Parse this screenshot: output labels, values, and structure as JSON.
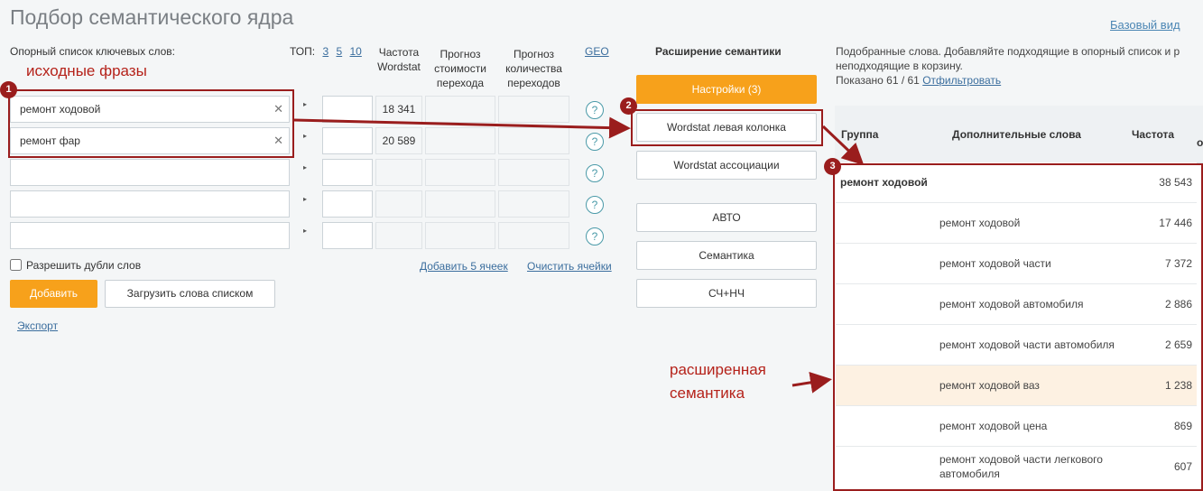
{
  "page": {
    "title": "Подбор семантического ядра",
    "base_view_link": "Базовый вид"
  },
  "keywords": {
    "label": "Опорный список ключевых слов:",
    "top_label": "ТОП:",
    "top_options": [
      "3",
      "5",
      "10"
    ],
    "col_freq": [
      "Частота",
      "Wordstat"
    ],
    "col_cost": [
      "Прогноз",
      "стоимости",
      "перехода"
    ],
    "col_count": [
      "Прогноз",
      "количества",
      "переходов"
    ],
    "geo": "GEO",
    "rows": [
      {
        "phrase": "ремонт ходовой",
        "freq": "18 341"
      },
      {
        "phrase": "ремонт фар",
        "freq": "20 589"
      },
      {
        "phrase": "",
        "freq": ""
      },
      {
        "phrase": "",
        "freq": ""
      },
      {
        "phrase": "",
        "freq": ""
      }
    ],
    "clear_glyph": "✕",
    "help_glyph": "?",
    "arrow_glyph": "▸",
    "allow_dups": "Разрешить дубли слов",
    "add5": "Добавить 5 ячеек",
    "clear_cells": "Очистить ячейки",
    "add_button": "Добавить",
    "load_button": "Загрузить слова списком",
    "export": "Экспорт"
  },
  "annotations": {
    "source_phrases": "исходные фразы",
    "expanded_1": "расширенная",
    "expanded_2": "семантика",
    "badge1": "1",
    "badge2": "2",
    "badge3": "3",
    "color": "#9a1d1d"
  },
  "extension": {
    "title": "Расширение семантики",
    "settings": "Настройки (3)",
    "wordstat_left": "Wordstat левая колонка",
    "wordstat_assoc": "Wordstat ассоциации",
    "auto": "АВТО",
    "semantics": "Семантика",
    "sch_nch": "СЧ+НЧ",
    "accent": "#f7a11b"
  },
  "results": {
    "info_1": "Подобранные слова. Добавляйте подходящие в опорный список и р",
    "info_2": "неподходящие в корзину.",
    "shown": "Показано 61 / 61",
    "filter": "Отфильтровать",
    "head_group": "Группа",
    "head_words": "Дополнительные слова",
    "head_freq": "Частота",
    "head_extra": "о",
    "group_row": {
      "name": "ремонт ходовой",
      "freq": "38 543"
    },
    "rows": [
      {
        "word": "ремонт ходовой",
        "freq": "17 446"
      },
      {
        "word": "ремонт ходовой части",
        "freq": "7 372"
      },
      {
        "word": "ремонт ходовой автомобиля",
        "freq": "2 886"
      },
      {
        "word": "ремонт ходовой части автомобиля",
        "freq": "2 659"
      },
      {
        "word": "ремонт ходовой ваз",
        "freq": "1 238"
      },
      {
        "word": "ремонт ходовой цена",
        "freq": "869"
      },
      {
        "word": "ремонт ходовой части легкового автомобиля",
        "freq": "607"
      }
    ]
  }
}
